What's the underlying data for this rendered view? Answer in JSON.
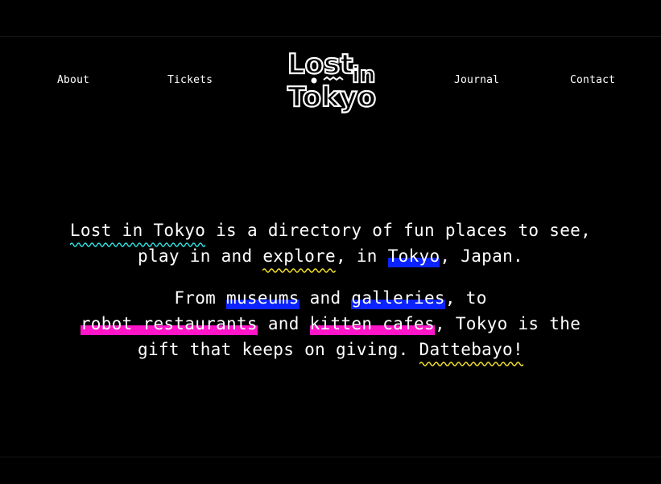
{
  "nav": {
    "about": "About",
    "tickets": "Tickets",
    "journal": "Journal",
    "contact": "Contact"
  },
  "logo": {
    "line1": "Lost",
    "line1b": "in",
    "line2": "Tokyo"
  },
  "intro": {
    "p1_a": "Lost in Tokyo",
    "p1_b": " is a directory of fun places to see, play in and ",
    "p1_c": "explore",
    "p1_d": ", in ",
    "p1_e": "Tokyo",
    "p1_f": ", Japan.",
    "p2_a": "From ",
    "p2_b": "museums",
    "p2_c": " and ",
    "p2_d": "galleries",
    "p2_e": ", to ",
    "p2_f": "robot restaurants",
    "p2_g": " and ",
    "p2_h": "kitten cafes",
    "p2_i": ", Tokyo is the gift that keeps on giving. ",
    "p2_j": "Dattebayo!"
  },
  "colors": {
    "cyan": "#2ee6e6",
    "yellow": "#f4e12a",
    "blue": "#0a23ff",
    "pink": "#ff14c8"
  }
}
